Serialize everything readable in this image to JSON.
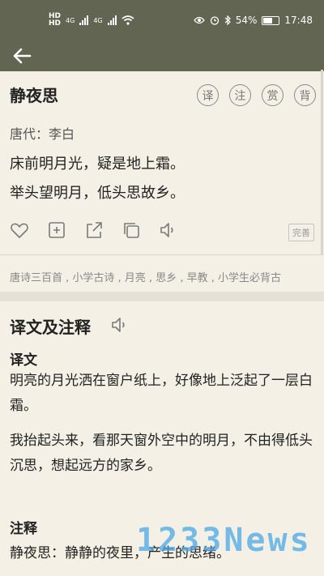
{
  "status": {
    "time": "17:48",
    "battery": "54%",
    "network_left": "4G",
    "network_right": "4G"
  },
  "poem": {
    "title": "静夜思",
    "buttons": [
      "译",
      "注",
      "赏",
      "背"
    ],
    "author": "唐代：李白",
    "lines": [
      "床前明月光，疑是地上霜。",
      "举头望明月，低头思故乡。"
    ],
    "done_label": "完善",
    "tags": "唐诗三百首 , 小学古诗 , 月亮 , 思乡 , 早教 , 小学生必背古"
  },
  "icons": {
    "back": "arrow-left-icon",
    "like": "heart-icon",
    "add": "plus-square-icon",
    "share": "share-icon",
    "copy": "copy-icon",
    "sound": "speaker-icon"
  },
  "translation": {
    "section_title": "译文及注释",
    "translation_title": "译文",
    "translation_p1": "明亮的月光洒在窗户纸上，好像地上泛起了一层白霜。",
    "translation_p2": "我抬起头来，看那天窗外空中的明月，不由得低头沉思，想起远方的家乡。",
    "notes_title": "注释",
    "notes_p1": "静夜思：静静的夜里，产生的思绪。"
  },
  "watermark": "1233News",
  "colors": {
    "appbar": "#626551",
    "background": "#f4f0e6",
    "watermark": "#4aa8e8"
  }
}
